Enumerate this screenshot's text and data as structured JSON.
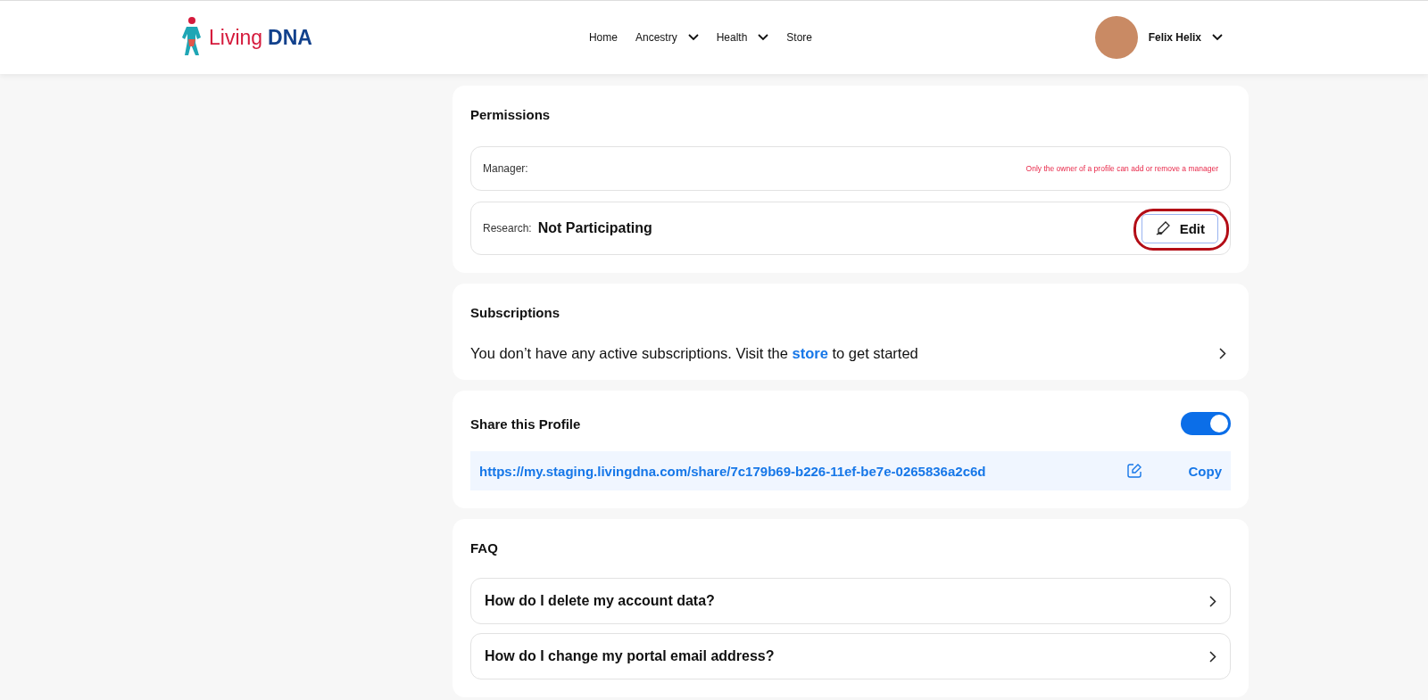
{
  "header": {
    "logo": {
      "word1": "Living",
      "word2": "DNA"
    },
    "nav": [
      {
        "label": "Home",
        "has_menu": false
      },
      {
        "label": "Ancestry",
        "has_menu": true
      },
      {
        "label": "Health",
        "has_menu": true
      },
      {
        "label": "Store",
        "has_menu": false
      }
    ],
    "user": {
      "name": "Felix Helix"
    }
  },
  "permissions": {
    "title": "Permissions",
    "manager_label": "Manager:",
    "manager_note": "Only the owner of a profile can add or remove a manager",
    "research_label": "Research:",
    "research_value": "Not Participating",
    "edit_button": "Edit",
    "edit_highlighted": true
  },
  "subscriptions": {
    "title": "Subscriptions",
    "message": "You don’t have any active subscriptions. Visit the",
    "link": "store",
    "message_end": "to get started"
  },
  "share": {
    "title": "Share this Profile",
    "enabled": true,
    "url": "https://my.staging.livingdna.com/share/7c179b69-b226-11ef-be7e-0265836a2c6d",
    "copy_button": "Copy"
  },
  "faq": {
    "title": "FAQ",
    "items": [
      {
        "question": "How do I delete my account data?"
      },
      {
        "question": "How do I change my portal email address?"
      }
    ]
  }
}
